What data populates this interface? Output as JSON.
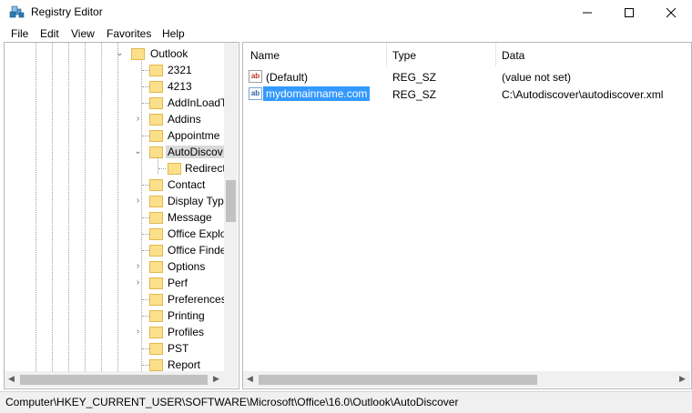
{
  "window": {
    "title": "Registry Editor"
  },
  "menu": [
    "File",
    "Edit",
    "View",
    "Favorites",
    "Help"
  ],
  "tree": {
    "nodes": [
      {
        "label": "Outlook",
        "expanded": true
      },
      {
        "label": "2321"
      },
      {
        "label": "4213"
      },
      {
        "label": "AddInLoadT"
      },
      {
        "label": "Addins",
        "collapsed": true
      },
      {
        "label": "Appointme"
      },
      {
        "label": "AutoDiscov",
        "expanded": true,
        "selected": true
      },
      {
        "label": "Redirect",
        "child": true
      },
      {
        "label": "Contact"
      },
      {
        "label": "Display Typ"
      },
      {
        "label": "Message"
      },
      {
        "label": "Office Explo"
      },
      {
        "label": "Office Finde"
      },
      {
        "label": "Options",
        "collapsed": true
      },
      {
        "label": "Perf",
        "collapsed": true
      },
      {
        "label": "Preferences"
      },
      {
        "label": "Printing"
      },
      {
        "label": "Profiles",
        "collapsed": true
      },
      {
        "label": "PST"
      },
      {
        "label": "Report"
      }
    ]
  },
  "list": {
    "columns": [
      "Name",
      "Type",
      "Data"
    ],
    "rows": [
      {
        "name": "(Default)",
        "type": "REG_SZ",
        "data": "(value not set)",
        "icon": "ab"
      },
      {
        "name": "mydomainname.com",
        "type": "REG_SZ",
        "data": "C:\\Autodiscover\\autodiscover.xml",
        "icon": "ab",
        "selected": true
      }
    ]
  },
  "status": {
    "path": "Computer\\HKEY_CURRENT_USER\\SOFTWARE\\Microsoft\\Office\\16.0\\Outlook\\AutoDiscover"
  },
  "colors": {
    "selection": "#3399ff",
    "folder": "#fbe08c",
    "tree_selected": "#d9d9d9"
  }
}
